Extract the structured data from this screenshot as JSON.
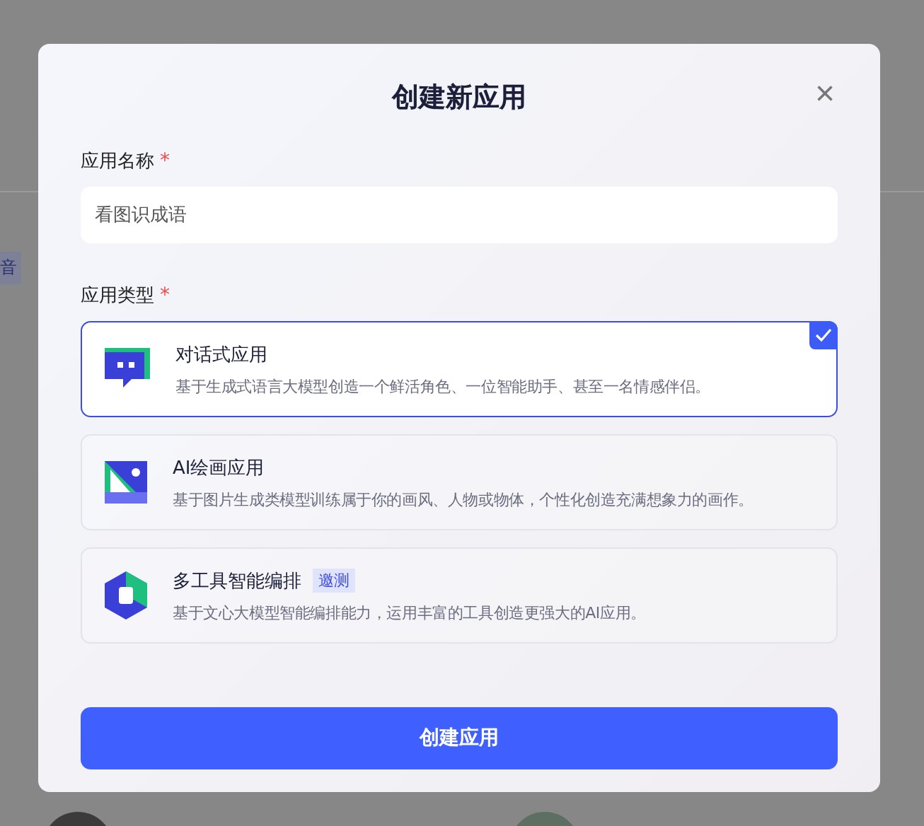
{
  "background": {
    "tag": "音"
  },
  "dialog": {
    "title": "创建新应用",
    "close": "×",
    "name_field": {
      "label": "应用名称",
      "required": "*",
      "value": "看图识成语"
    },
    "type_field": {
      "label": "应用类型",
      "required": "*"
    },
    "app_types": [
      {
        "kind": "chat",
        "title": "对话式应用",
        "description": "基于生成式语言大模型创造一个鲜活角色、一位智能助手、甚至一名情感伴侣。",
        "selected": true
      },
      {
        "kind": "paint",
        "title": "AI绘画应用",
        "description": "基于图片生成类模型训练属于你的画风、人物或物体，个性化创造充满想象力的画作。",
        "selected": false
      },
      {
        "kind": "tools",
        "title": "多工具智能编排",
        "badge": "邀测",
        "description": "基于文心大模型智能编排能力，运用丰富的工具创造更强大的AI应用。",
        "selected": false
      }
    ],
    "submit": "创建应用"
  }
}
